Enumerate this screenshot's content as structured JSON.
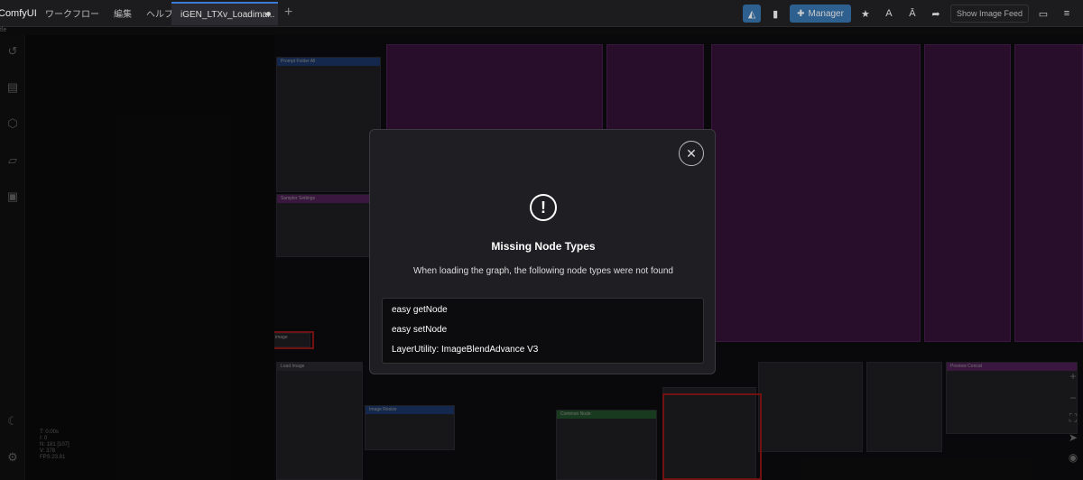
{
  "app": {
    "name": "ComfyUI"
  },
  "menu": [
    "ワークフロー",
    "編集",
    "ヘルプ"
  ],
  "tab": {
    "label": "iGEN_LTXv_Loadima..."
  },
  "toolbar": {
    "manager_label": "Manager",
    "feed_label": "Show Image Feed"
  },
  "subbar": {
    "label": "tle"
  },
  "stats": [
    "T: 0.00s",
    "I: 0",
    "N: 181 [107]",
    "V: 378",
    "FPS:23.81"
  ],
  "canvas_nodes": {
    "prompt_node": "Prompt Folder All",
    "sampler_settings": "Sampler Settings",
    "image_node": "image",
    "load_image": "Load Image",
    "image_resize": "Image Resize",
    "common_node": "Common Node",
    "preview_concat": "Preview Concat"
  },
  "dialog": {
    "title": "Missing Node Types",
    "subtitle": "When loading the graph, the following node types were not found",
    "missing": [
      "easy getNode",
      "easy setNode",
      "LayerUtility: ImageBlendAdvance V3"
    ]
  }
}
